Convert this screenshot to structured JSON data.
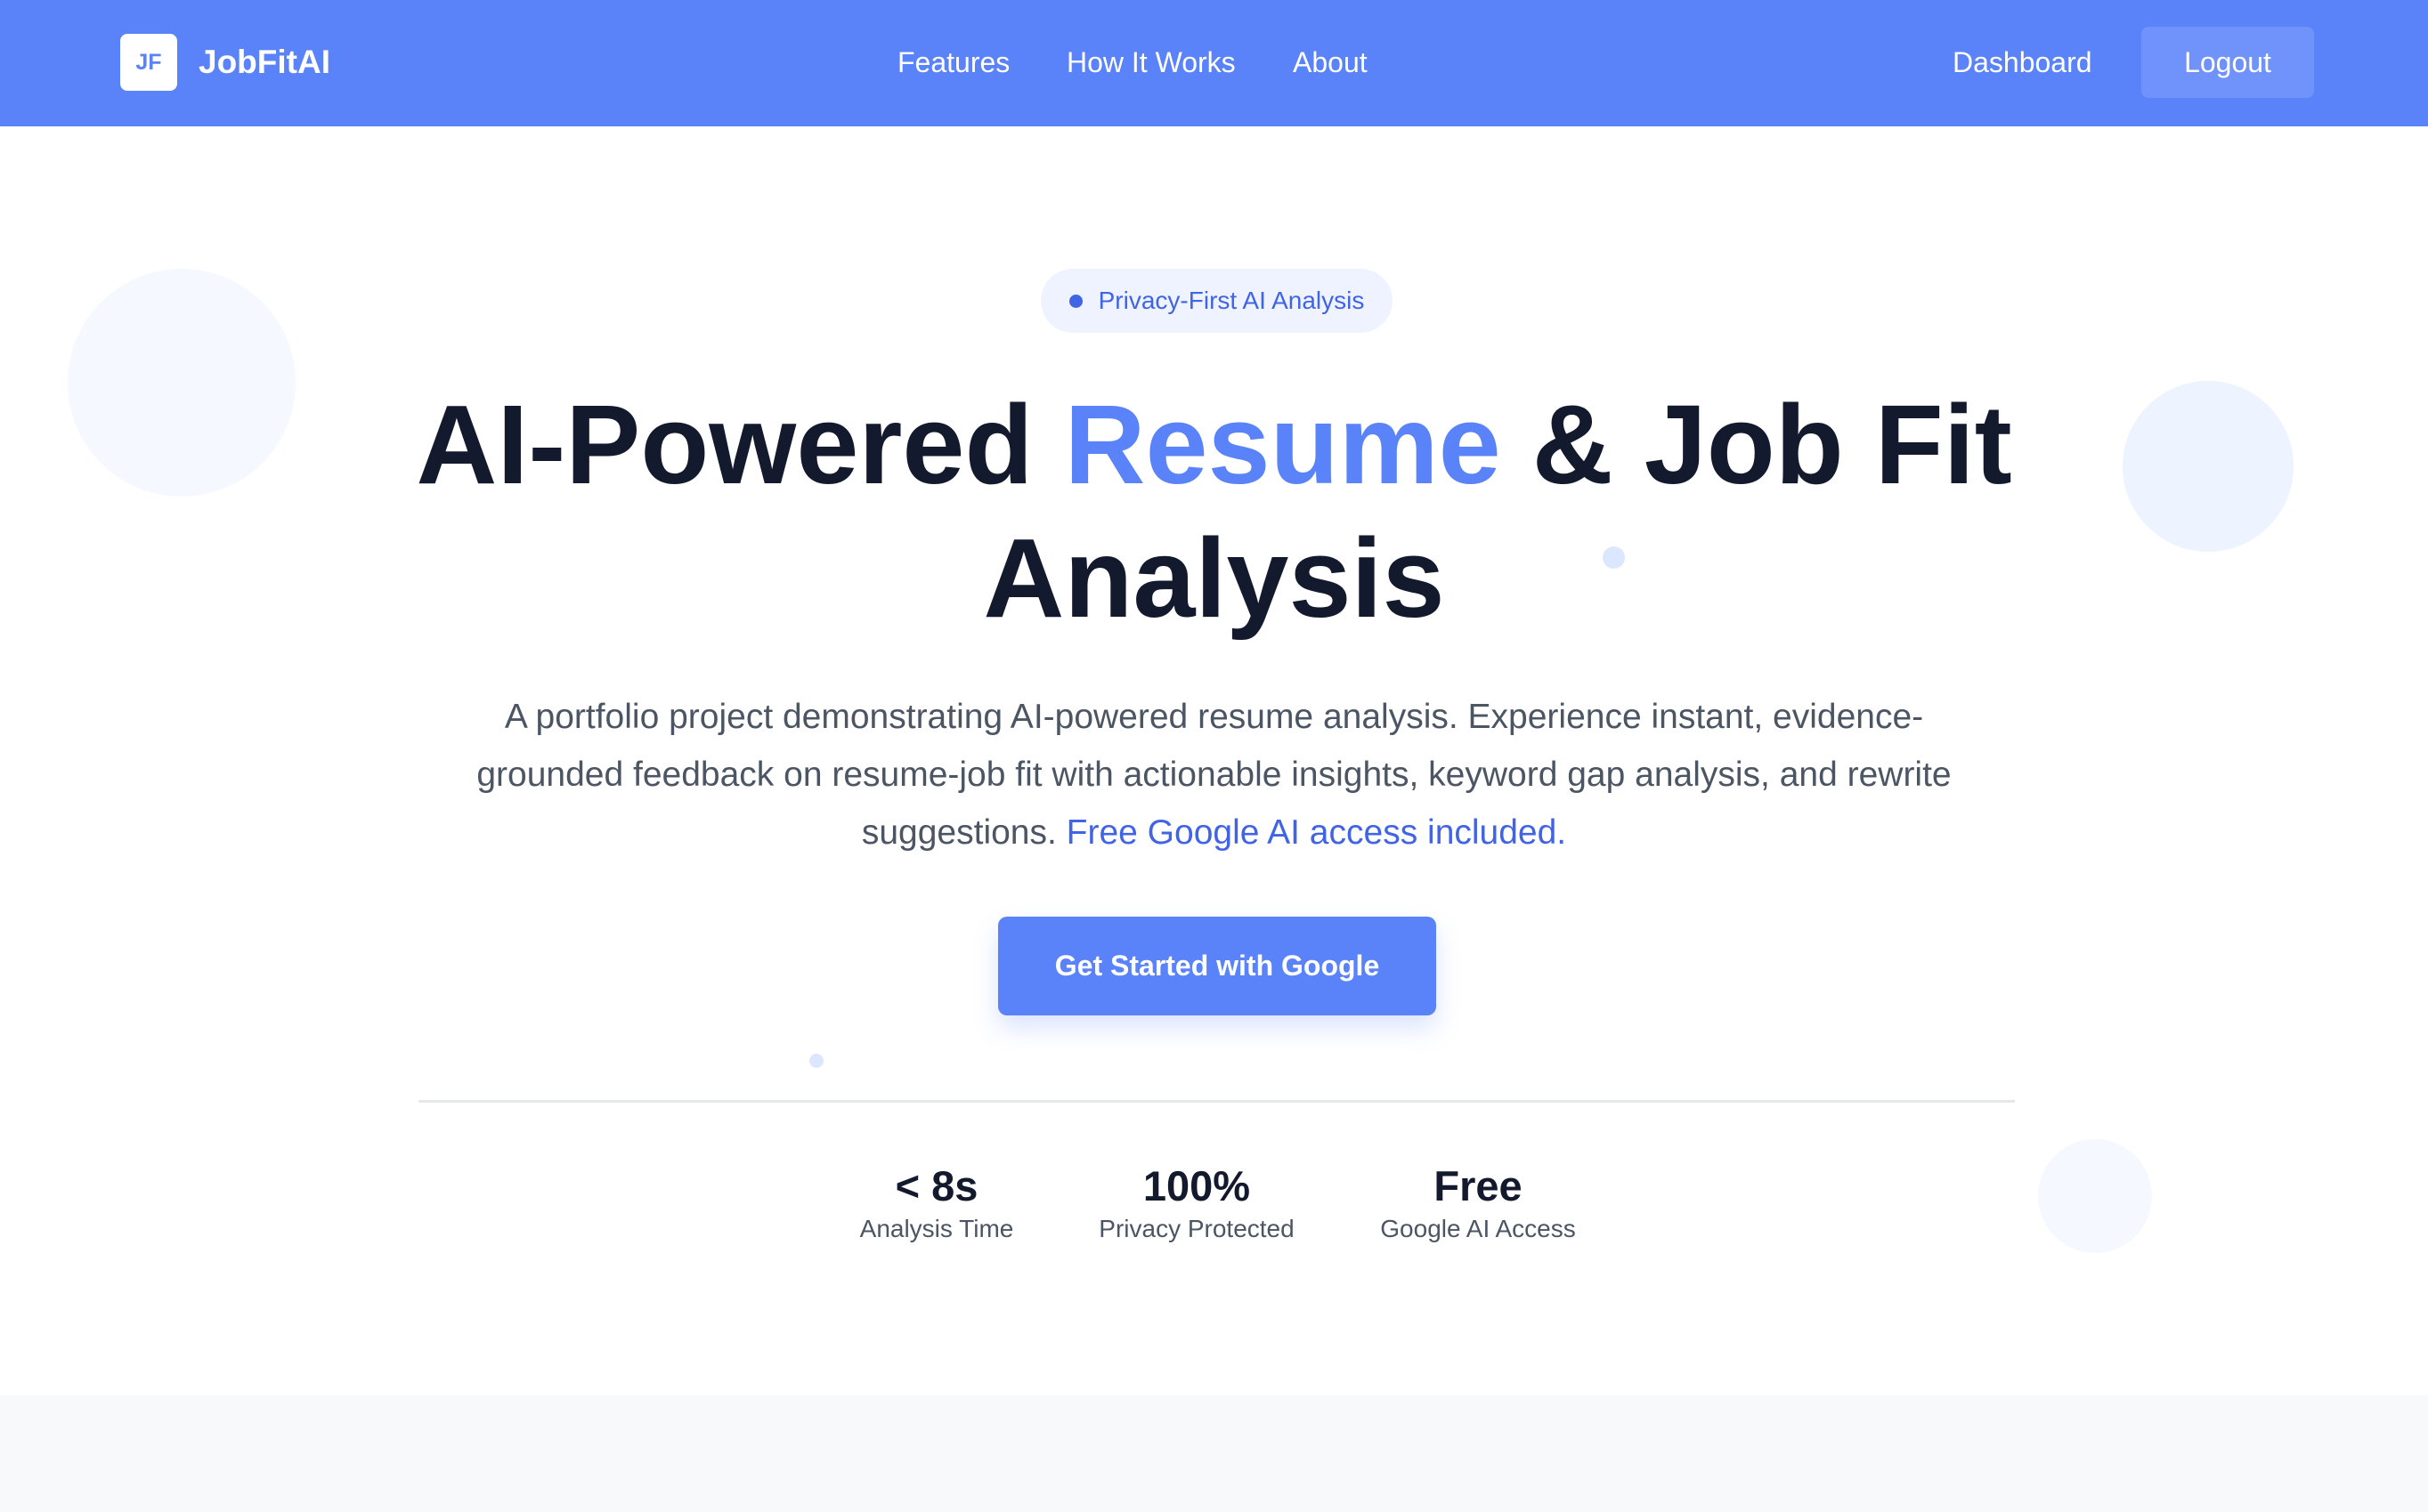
{
  "brand": {
    "logo_mark": "JF",
    "name": "JobFitAI",
    "primary_color": "#5a82f9",
    "accent_text_color": "#4164e6"
  },
  "nav": {
    "links": [
      "Features",
      "How It Works",
      "About"
    ],
    "dashboard": "Dashboard",
    "logout": "Logout"
  },
  "hero": {
    "badge": "Privacy-First AI Analysis",
    "title_part1": "AI-Powered ",
    "title_accent": "Resume",
    "title_part2": " & Job Fit Analysis",
    "description": "A portfolio project demonstrating AI-powered resume analysis. Experience instant, evidence-grounded feedback on resume-job fit with actionable insights, keyword gap analysis, and rewrite suggestions. ",
    "description_link": "Free Google AI access included.",
    "cta": "Get Started with Google"
  },
  "stats": [
    {
      "value": "< 8s",
      "label": "Analysis Time"
    },
    {
      "value": "100%",
      "label": "Privacy Protected"
    },
    {
      "value": "Free",
      "label": "Google AI Access"
    }
  ]
}
